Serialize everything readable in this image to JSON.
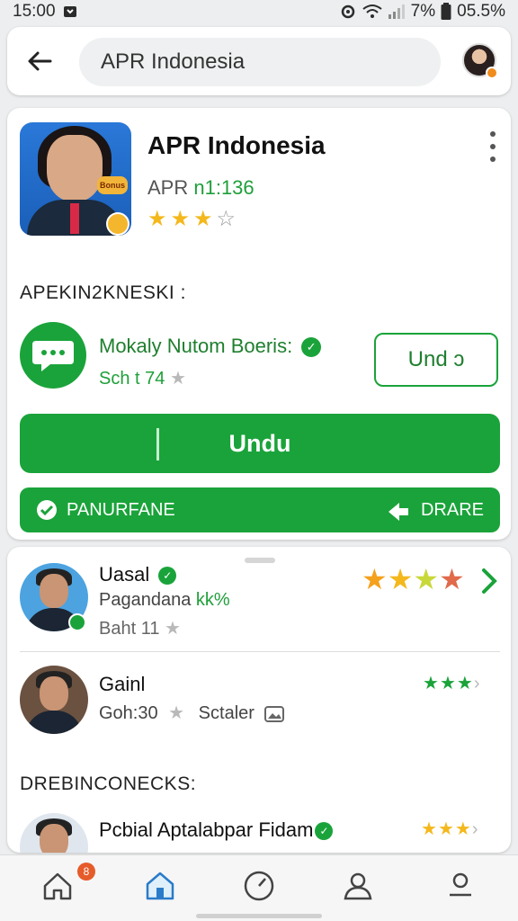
{
  "status": {
    "time": "15:00",
    "battery": "7%",
    "battery_level": "05.5%"
  },
  "search": {
    "value": "APR Indonesia"
  },
  "app": {
    "title": "APR Indonesia",
    "sub_prefix": "APR ",
    "sub_value": "n1:136",
    "badge_text": "Bonus",
    "rating": {
      "filled": 3,
      "half": 0,
      "empty": 1
    }
  },
  "section1": {
    "label": "APEKIN2KNESKI :"
  },
  "related": {
    "name": "Mokaly Nutom Boeris:",
    "sub": "Sch t 74",
    "button_label": "Und ↄ"
  },
  "primary": {
    "label": "Undu"
  },
  "bar": {
    "left_label": "PANURFANE",
    "right_label": "DRARE"
  },
  "list": {
    "items": [
      {
        "title": "Uasal",
        "line2": "Pagandana",
        "line2_accent": "kk%",
        "line3": "Baht 11"
      },
      {
        "title": "Gainl",
        "line2": "Goh:30",
        "line2_extra": "Sctaler"
      }
    ]
  },
  "section2": {
    "label": "DREBINCONECKS:"
  },
  "row3": {
    "title": "Pcbial Aptalabpar Fidam"
  },
  "nav": {
    "badge": "8"
  },
  "colors": {
    "green": "#1aa33a",
    "star": "#f4b81d",
    "accent_orange": "#f08b1d"
  }
}
